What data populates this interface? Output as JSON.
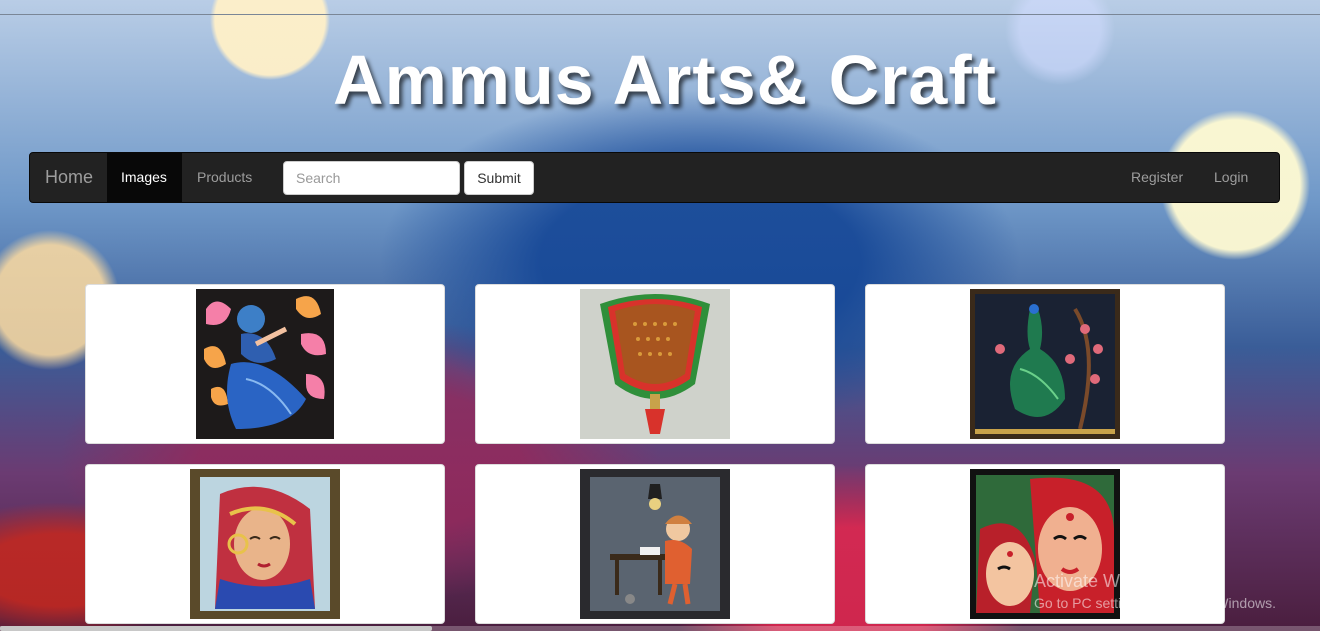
{
  "site": {
    "title": "Ammus Arts& Craft"
  },
  "navbar": {
    "brand": "Home",
    "links": [
      {
        "label": "Images",
        "active": true
      },
      {
        "label": "Products",
        "active": false
      }
    ],
    "search": {
      "placeholder": "Search",
      "value": ""
    },
    "submit_label": "Submit",
    "right_links": [
      {
        "label": "Register"
      },
      {
        "label": "Login"
      }
    ]
  },
  "gallery": {
    "items": [
      {
        "subject": "dancing woman painting with pink leaves"
      },
      {
        "subject": "kathakali crown wall hanging"
      },
      {
        "subject": "peacock glass painting"
      },
      {
        "subject": "rajasthani bride painting"
      },
      {
        "subject": "girl writing at desk painting"
      },
      {
        "subject": "two women faces painting"
      }
    ]
  },
  "watermark": {
    "title": "Activate Windows",
    "subtitle": "Go to PC settings to activate Windows."
  },
  "colors": {
    "navbar_bg": "#222222",
    "navbar_active_bg": "#080808",
    "nav_text": "#9d9d9d",
    "card_bg": "#ffffff"
  }
}
